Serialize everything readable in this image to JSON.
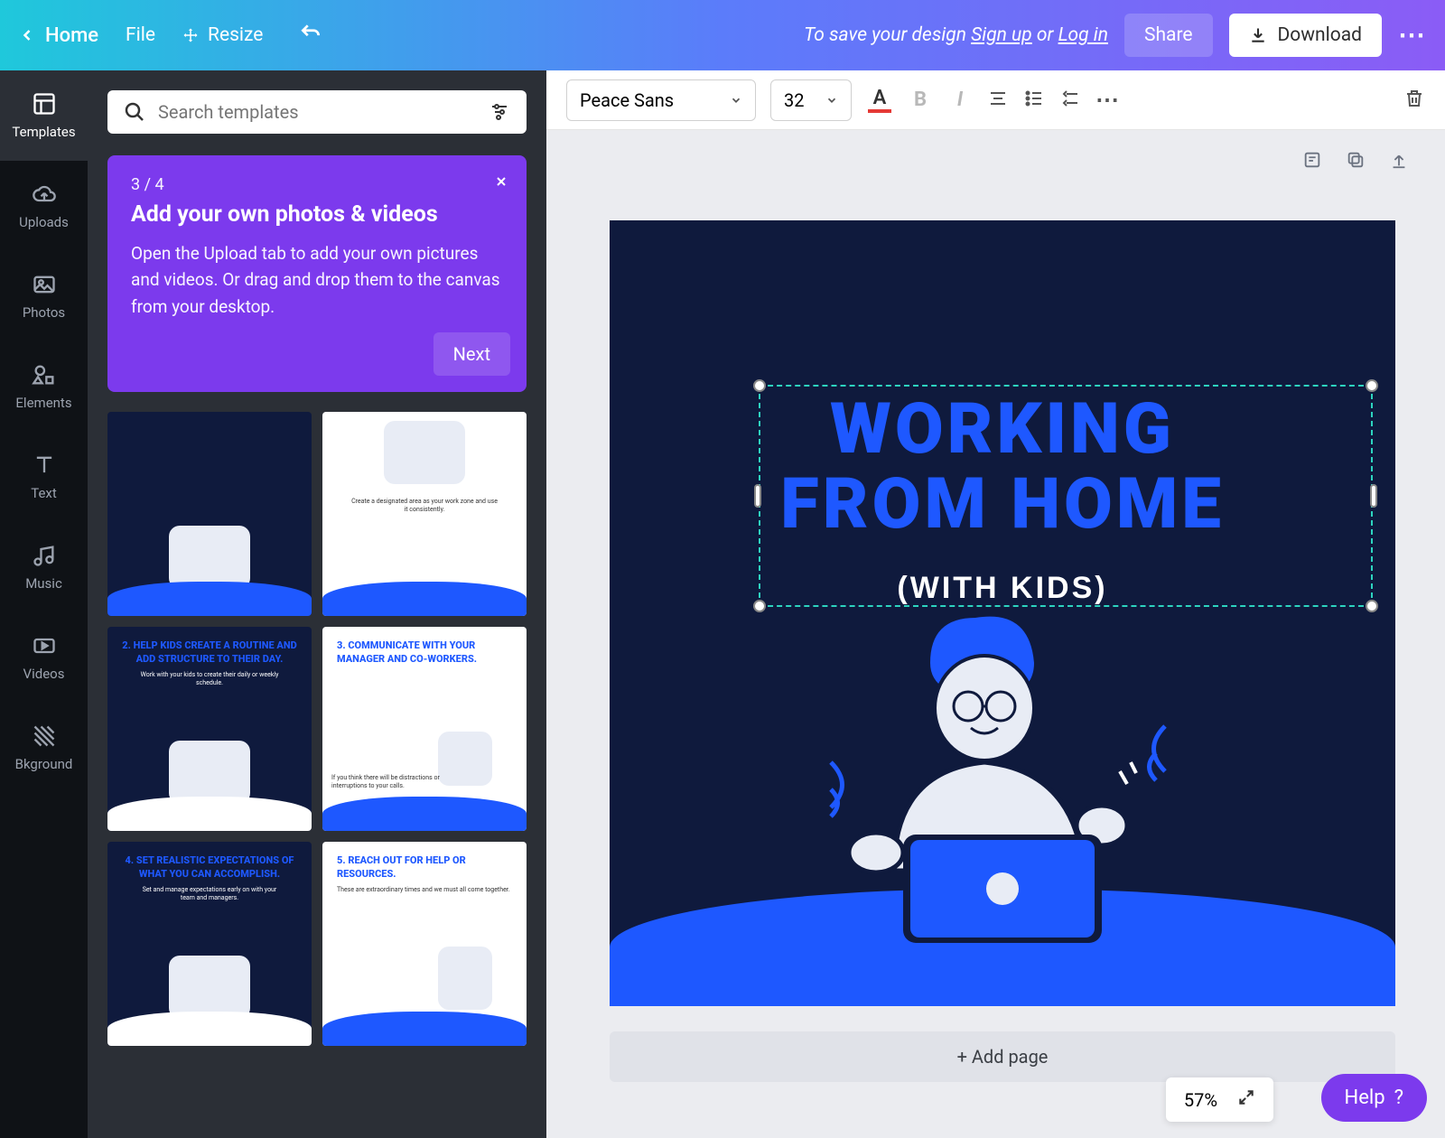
{
  "topbar": {
    "home": "Home",
    "file": "File",
    "resize": "Resize",
    "save_prompt_prefix": "To save your design ",
    "signup": "Sign up",
    "or": " or ",
    "login": "Log in",
    "share": "Share",
    "download": "Download"
  },
  "toolbar": {
    "font": "Peace Sans",
    "font_size": "32"
  },
  "rail": {
    "templates": "Templates",
    "uploads": "Uploads",
    "photos": "Photos",
    "elements": "Elements",
    "text": "Text",
    "music": "Music",
    "videos": "Videos",
    "background": "Bkground"
  },
  "search": {
    "placeholder": "Search templates"
  },
  "coachmark": {
    "step": "3 / 4",
    "title": "Add your own photos & videos",
    "body": "Open the Upload tab to add your own pictures and videos. Or drag and drop them to the canvas from your desktop.",
    "next": "Next"
  },
  "templates": [
    {
      "heading": "",
      "sub": "",
      "dark": true
    },
    {
      "heading": "",
      "sub": "Create a designated area as your work zone and use it consistently.",
      "dark": false
    },
    {
      "heading": "2. HELP KIDS CREATE A ROUTINE AND ADD STRUCTURE TO THEIR DAY.",
      "sub": "Work with your kids to create their daily or weekly schedule.",
      "dark": true
    },
    {
      "heading": "3. COMMUNICATE WITH YOUR MANAGER AND CO-WORKERS.",
      "sub": "If you think there will be distractions or interruptions to your calls.",
      "dark": false
    },
    {
      "heading": "4. SET REALISTIC EXPECTATIONS OF WHAT YOU CAN ACCOMPLISH.",
      "sub": "Set and manage expectations early on with your team and managers.",
      "dark": true
    },
    {
      "heading": "5. REACH OUT FOR HELP OR RESOURCES.",
      "sub": "These are extraordinary times and we must all come together.",
      "dark": false
    }
  ],
  "canvas": {
    "title_line1": "WORKING",
    "title_line2": "FROM HOME",
    "subtitle": "(WITH KIDS)",
    "add_page": "+ Add page"
  },
  "zoom": {
    "percent": "57%"
  },
  "help": {
    "label": "Help",
    "q": "?"
  }
}
